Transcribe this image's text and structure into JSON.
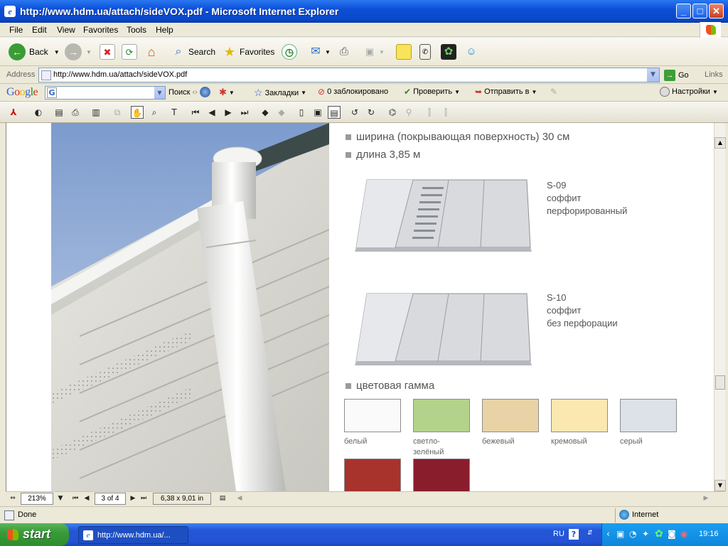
{
  "window": {
    "title": "http://www.hdm.ua/attach/sideVOX.pdf - Microsoft Internet Explorer",
    "minimize": "_",
    "maximize": "□",
    "close": "✕"
  },
  "menu": [
    "File",
    "Edit",
    "View",
    "Favorites",
    "Tools",
    "Help"
  ],
  "toolbar": {
    "back": "Back",
    "search": "Search",
    "favorites": "Favorites"
  },
  "address": {
    "label": "Address",
    "url": "http://www.hdm.ua/attach/sideVOX.pdf",
    "go": "Go",
    "links": "Links"
  },
  "google": {
    "logo": "Google",
    "search_label": "Поиск",
    "bookmarks": "Закладки",
    "blocked": "0 заблокировано",
    "check": "Проверить",
    "send": "Отправить в",
    "settings": "Настройки"
  },
  "doc": {
    "spec_width": "ширина (покрывающая поверхность) 30 см",
    "spec_length": "длина 3,85 м",
    "s09": {
      "code": "S-09",
      "name": "соффит",
      "desc": "перфорированный"
    },
    "s10": {
      "code": "S-10",
      "name": "соффит",
      "desc": "без перфорации"
    },
    "colors_heading": "цветовая гамма",
    "colors": [
      {
        "label": "белый",
        "hex": "#fafafa"
      },
      {
        "label": "светло-\nзелёный",
        "hex": "#b3d38d"
      },
      {
        "label": "бежевый",
        "hex": "#e9d3a6"
      },
      {
        "label": "кремовый",
        "hex": "#fbe8b0"
      },
      {
        "label": "серый",
        "hex": "#dde1e8"
      },
      {
        "label": "",
        "hex": "#a8322c"
      },
      {
        "label": "",
        "hex": "#8a1d2c"
      }
    ]
  },
  "pdf_status": {
    "zoom": "213%",
    "page": "3 of 4",
    "size": "6,38 x 9,01 in"
  },
  "ie_status": {
    "text": "Done",
    "zone": "Internet"
  },
  "taskbar": {
    "start": "start",
    "item": "http://www.hdm.ua/...",
    "lang": "RU",
    "time": "19:16"
  }
}
